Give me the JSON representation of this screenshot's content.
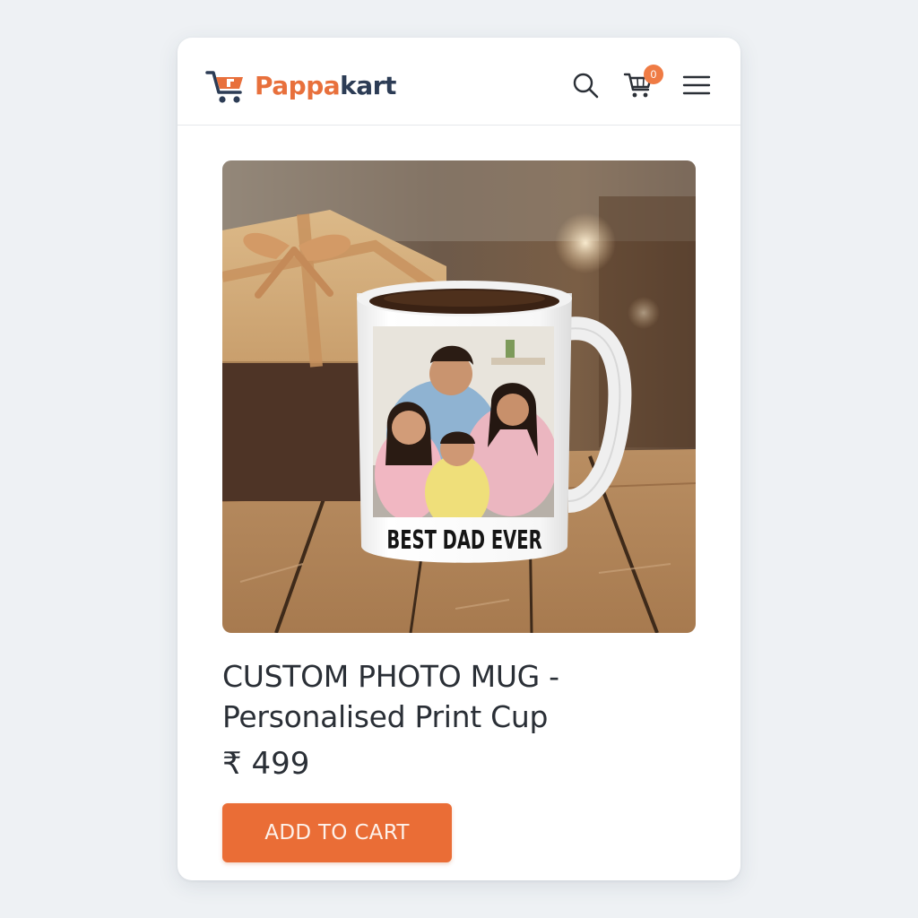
{
  "colors": {
    "accent": "#ea6d36",
    "brand_orange": "#e8703c",
    "brand_navy": "#2c3c55",
    "text": "#2a2f36",
    "badge": "#ef7b44"
  },
  "header": {
    "brand_part1": "Pappa",
    "brand_part2": "kart",
    "logo_icon": "shopping-cart-logo-icon",
    "cart_count": "0",
    "icons": [
      "search-icon",
      "cart-icon",
      "hamburger-menu-icon"
    ]
  },
  "product": {
    "image_icon": "product-photo-mug",
    "mug_print_text": "BEST DAD EVER",
    "title": "CUSTOM PHOTO MUG - Personalised Print Cup",
    "price": "₹ 499",
    "add_to_cart_label": "ADD TO CART"
  }
}
